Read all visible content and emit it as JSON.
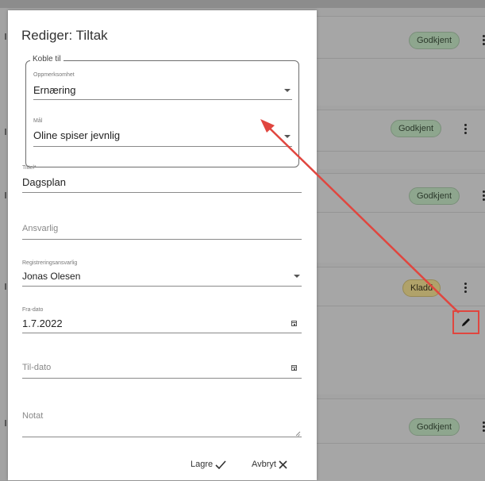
{
  "background": {
    "badges": [
      "Godkjent",
      "Godkjent",
      "Godkjent",
      "Kladd",
      "Godkjent"
    ]
  },
  "dialog": {
    "title": "Rediger: Tiltak",
    "link_group": {
      "legend": "Koble til",
      "focus_area": {
        "label": "Oppmerksomhet",
        "value": "Ernæring"
      },
      "goal": {
        "label": "Mål",
        "value": "Oline spiser jevnlig"
      }
    },
    "title_field": {
      "label": "Tittel*",
      "value": "Dagsplan"
    },
    "responsible": {
      "placeholder": "Ansvarlig"
    },
    "registration_responsible": {
      "label": "Registreringsansvarlig",
      "value": "Jonas Olesen"
    },
    "from_date": {
      "label": "Fra-dato",
      "value": "1.7.2022"
    },
    "to_date": {
      "placeholder": "Til-dato"
    },
    "note": {
      "placeholder": "Notat"
    },
    "save_label": "Lagre",
    "cancel_label": "Avbryt"
  },
  "annotation": {
    "color": "#e0463f",
    "icon": "pencil-icon"
  }
}
